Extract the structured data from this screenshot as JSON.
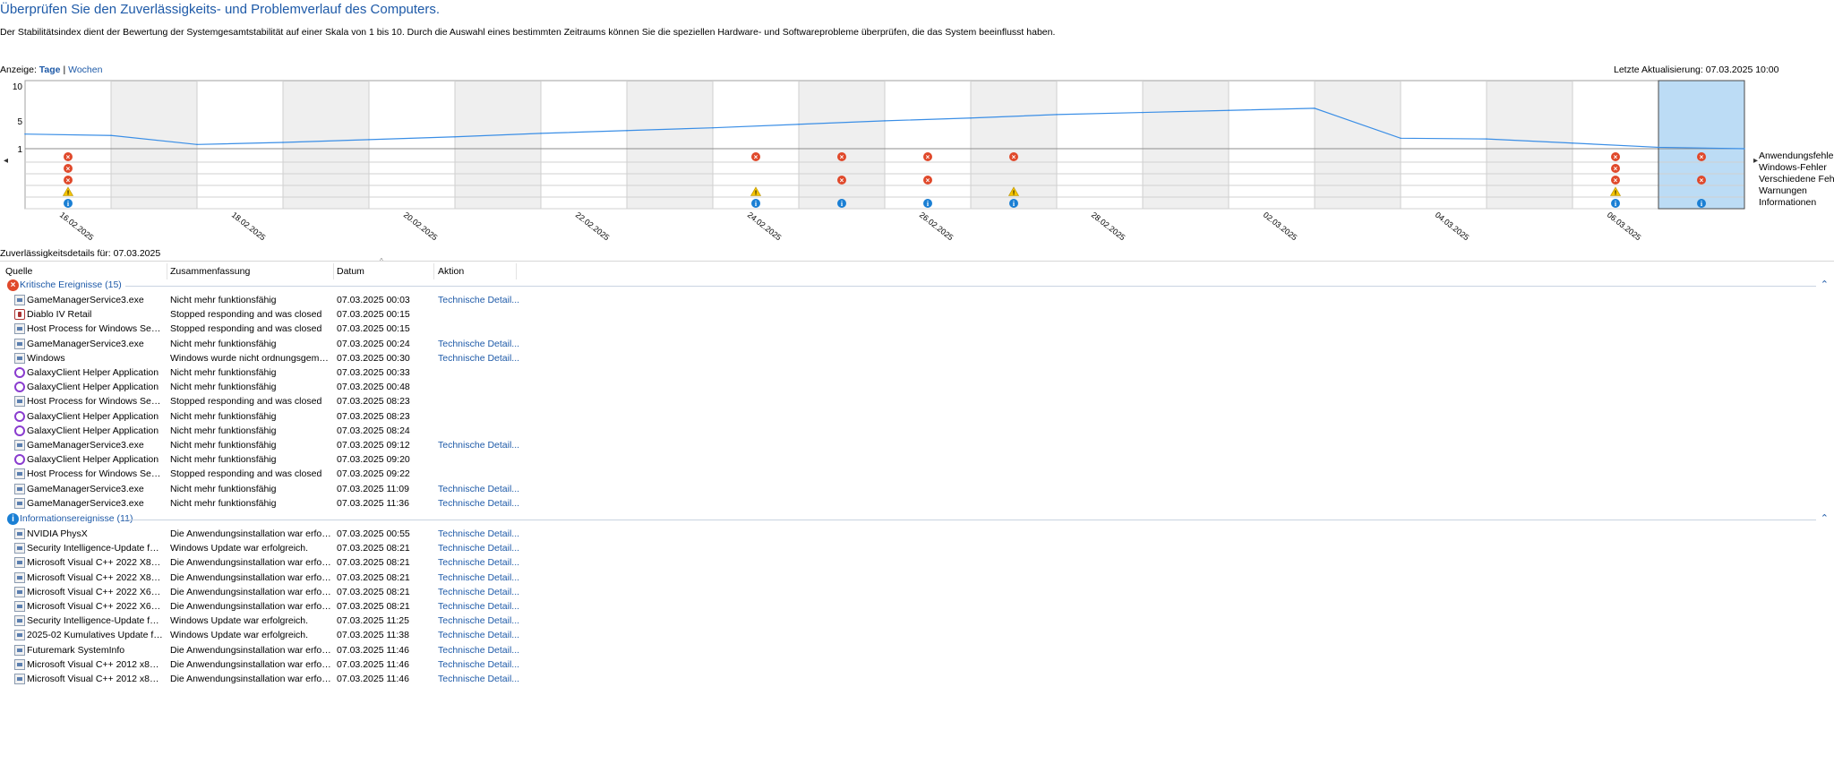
{
  "header": {
    "title": "Überprüfen Sie den Zuverlässigkeits- und Problemverlauf des Computers.",
    "description": "Der Stabilitätsindex dient der Bewertung der Systemgesamtstabilität auf einer Skala von 1 bis 10. Durch die Auswahl eines bestimmten Zeitraums können Sie die speziellen Hardware- und Softwareprobleme überprüfen, die das System beeinflusst haben.",
    "view_label": "Anzeige:",
    "view_days": "Tage",
    "view_sep": "|",
    "view_weeks": "Wochen",
    "last_update": "Letzte Aktualisierung: 07.03.2025 10:00"
  },
  "chart": {
    "y_ticks": [
      "10",
      "5",
      "1"
    ],
    "date_labels": [
      "16.02.2025",
      "18.02.2025",
      "20.02.2025",
      "22.02.2025",
      "24.02.2025",
      "26.02.2025",
      "28.02.2025",
      "02.03.2025",
      "04.03.2025",
      "06.03.2025"
    ],
    "legend": [
      "Anwendungsfehler",
      "Windows-Fehler",
      "Verschiedene Fehler",
      "Warnungen",
      "Informationen"
    ],
    "selected_day_index": 19,
    "nav_left": "◂",
    "nav_right": "▸",
    "colors": {
      "line": "#3a8ee6",
      "selected": "#bcdcf5",
      "shaded": "#efefef",
      "error": "#e0492b",
      "warning": "#f5c400",
      "info": "#1a7fd4"
    },
    "events": {
      "app_errors": [
        0,
        8,
        9,
        10,
        11,
        18,
        19
      ],
      "windows_errors": [
        0,
        18
      ],
      "misc_errors": [
        0,
        9,
        10,
        18,
        19
      ],
      "warnings": [
        0,
        8,
        11,
        18
      ],
      "infos": [
        0,
        8,
        9,
        10,
        11,
        18,
        19
      ]
    }
  },
  "chart_data": {
    "type": "line",
    "title": "",
    "xlabel": "",
    "ylabel": "",
    "ylim": [
      1,
      10
    ],
    "x": [
      "15.02.2025",
      "16.02.2025",
      "17.02.2025",
      "18.02.2025",
      "19.02.2025",
      "20.02.2025",
      "21.02.2025",
      "22.02.2025",
      "23.02.2025",
      "24.02.2025",
      "25.02.2025",
      "26.02.2025",
      "27.02.2025",
      "28.02.2025",
      "01.03.2025",
      "02.03.2025",
      "03.03.2025",
      "04.03.2025",
      "05.03.2025",
      "06.03.2025",
      "07.03.2025"
    ],
    "series": [
      {
        "values": [
          3.1,
          2.9,
          1.6,
          1.9,
          2.3,
          2.7,
          3.2,
          3.6,
          4.0,
          4.5,
          5.0,
          5.4,
          5.9,
          6.2,
          6.5,
          6.8,
          2.5,
          2.4,
          1.8,
          1.2,
          1.0
        ]
      }
    ]
  },
  "details": {
    "label": "Zuverlässigkeitsdetails für: 07.03.2025",
    "columns": [
      "Quelle",
      "Zusammenfassung",
      "Datum",
      "Aktion"
    ],
    "groups": [
      {
        "label": "Kritische Ereignisse (15)",
        "icon": "error-icon",
        "rows": [
          {
            "icon": "app",
            "source": "GameManagerService3.exe",
            "summary": "Nicht mehr funktionsfähig",
            "date": "07.03.2025 00:03",
            "action": "Technische Detail..."
          },
          {
            "icon": "game",
            "source": "Diablo IV Retail",
            "summary": "Stopped responding and was closed",
            "date": "07.03.2025 00:15",
            "action": ""
          },
          {
            "icon": "app",
            "source": "Host Process for Windows Services",
            "summary": "Stopped responding and was closed",
            "date": "07.03.2025 00:15",
            "action": ""
          },
          {
            "icon": "app",
            "source": "GameManagerService3.exe",
            "summary": "Nicht mehr funktionsfähig",
            "date": "07.03.2025 00:24",
            "action": "Technische Detail..."
          },
          {
            "icon": "app",
            "source": "Windows",
            "summary": "Windows wurde nicht ordnungsgemäß ...",
            "date": "07.03.2025 00:30",
            "action": "Technische Detail..."
          },
          {
            "icon": "ring",
            "source": "GalaxyClient Helper Application",
            "summary": "Nicht mehr funktionsfähig",
            "date": "07.03.2025 00:33",
            "action": ""
          },
          {
            "icon": "ring",
            "source": "GalaxyClient Helper Application",
            "summary": "Nicht mehr funktionsfähig",
            "date": "07.03.2025 00:48",
            "action": ""
          },
          {
            "icon": "app",
            "source": "Host Process for Windows Services",
            "summary": "Stopped responding and was closed",
            "date": "07.03.2025 08:23",
            "action": ""
          },
          {
            "icon": "ring",
            "source": "GalaxyClient Helper Application",
            "summary": "Nicht mehr funktionsfähig",
            "date": "07.03.2025 08:23",
            "action": ""
          },
          {
            "icon": "ring",
            "source": "GalaxyClient Helper Application",
            "summary": "Nicht mehr funktionsfähig",
            "date": "07.03.2025 08:24",
            "action": ""
          },
          {
            "icon": "app",
            "source": "GameManagerService3.exe",
            "summary": "Nicht mehr funktionsfähig",
            "date": "07.03.2025 09:12",
            "action": "Technische Detail..."
          },
          {
            "icon": "ring",
            "source": "GalaxyClient Helper Application",
            "summary": "Nicht mehr funktionsfähig",
            "date": "07.03.2025 09:20",
            "action": ""
          },
          {
            "icon": "app",
            "source": "Host Process for Windows Services",
            "summary": "Stopped responding and was closed",
            "date": "07.03.2025 09:22",
            "action": ""
          },
          {
            "icon": "app",
            "source": "GameManagerService3.exe",
            "summary": "Nicht mehr funktionsfähig",
            "date": "07.03.2025 11:09",
            "action": "Technische Detail..."
          },
          {
            "icon": "app",
            "source": "GameManagerService3.exe",
            "summary": "Nicht mehr funktionsfähig",
            "date": "07.03.2025 11:36",
            "action": "Technische Detail..."
          }
        ]
      },
      {
        "label": "Informationsereignisse (11)",
        "icon": "info-icon",
        "rows": [
          {
            "icon": "app",
            "source": "NVIDIA PhysX",
            "summary": "Die Anwendungsinstallation war erfolgr...",
            "date": "07.03.2025 00:55",
            "action": "Technische Detail..."
          },
          {
            "icon": "app",
            "source": "Security Intelligence-Update für M...",
            "summary": "Windows Update war erfolgreich.",
            "date": "07.03.2025 08:21",
            "action": "Technische Detail..."
          },
          {
            "icon": "app",
            "source": "Microsoft Visual C++ 2022 X86 Mi...",
            "summary": "Die Anwendungsinstallation war erfolgr...",
            "date": "07.03.2025 08:21",
            "action": "Technische Detail..."
          },
          {
            "icon": "app",
            "source": "Microsoft Visual C++ 2022 X86 Ad...",
            "summary": "Die Anwendungsinstallation war erfolgr...",
            "date": "07.03.2025 08:21",
            "action": "Technische Detail..."
          },
          {
            "icon": "app",
            "source": "Microsoft Visual C++ 2022 X64 Mi...",
            "summary": "Die Anwendungsinstallation war erfolgr...",
            "date": "07.03.2025 08:21",
            "action": "Technische Detail..."
          },
          {
            "icon": "app",
            "source": "Microsoft Visual C++ 2022 X64 Ad...",
            "summary": "Die Anwendungsinstallation war erfolgr...",
            "date": "07.03.2025 08:21",
            "action": "Technische Detail..."
          },
          {
            "icon": "app",
            "source": "Security Intelligence-Update für M...",
            "summary": "Windows Update war erfolgreich.",
            "date": "07.03.2025 11:25",
            "action": "Technische Detail..."
          },
          {
            "icon": "app",
            "source": "2025-02 Kumulatives Update für ...",
            "summary": "Windows Update war erfolgreich.",
            "date": "07.03.2025 11:38",
            "action": "Technische Detail..."
          },
          {
            "icon": "app",
            "source": "Futuremark SystemInfo",
            "summary": "Die Anwendungsinstallation war erfolgr...",
            "date": "07.03.2025 11:46",
            "action": "Technische Detail..."
          },
          {
            "icon": "app",
            "source": "Microsoft Visual C++ 2012 x86 Mi...",
            "summary": "Die Anwendungsinstallation war erfolgr...",
            "date": "07.03.2025 11:46",
            "action": "Technische Detail..."
          },
          {
            "icon": "app",
            "source": "Microsoft Visual C++ 2012 x86 Ad...",
            "summary": "Die Anwendungsinstallation war erfolgr...",
            "date": "07.03.2025 11:46",
            "action": "Technische Detail..."
          }
        ]
      }
    ]
  }
}
